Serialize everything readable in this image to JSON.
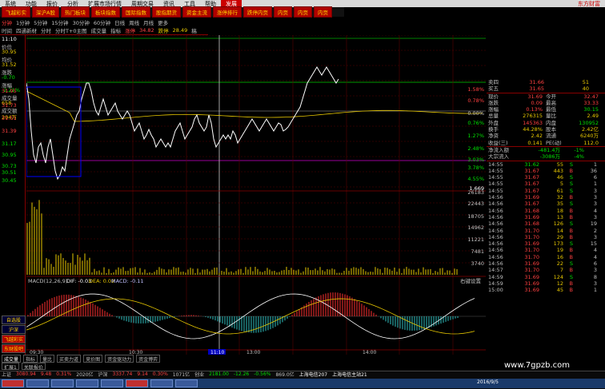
{
  "menubar": {
    "items": [
      "系统",
      "功能",
      "报价",
      "分析",
      "扩展市场行情",
      "周期交易",
      "资讯",
      "工具",
      "帮助"
    ],
    "highlight": "发展",
    "right": "东方财富"
  },
  "quick_tabs": [
    "飞越彩实",
    "深沪A股",
    "热门板块",
    "板块指数",
    "国际指数",
    "股指期货",
    "资金主流",
    "涨停排行",
    "跌停内页",
    "内页",
    "内页",
    "内页"
  ],
  "periods": {
    "items": [
      "分钟",
      "1分钟",
      "5分钟",
      "15分钟",
      "30分钟",
      "60分钟",
      "日线",
      "周线",
      "月线",
      "更多"
    ],
    "active": "分钟"
  },
  "chart_tools": {
    "items": [
      "时间",
      "四通新材",
      "分时",
      "分时T+0主图",
      "成交量",
      "指标",
      "涨停",
      "34.82",
      "跌停",
      "28.49",
      "稿"
    ]
  },
  "left_info": {
    "time_label": "11:10",
    "price_label": "价位",
    "price_value": "30.95",
    "avg_label": "均价",
    "avg_value": "31.52",
    "chg_label": "涨跌",
    "chg_value": "-0.70",
    "pct_label": "涨幅",
    "pct_value": "-2.21%",
    "vol_label": "成交量",
    "vol_value": "658",
    "amt_label": "成交额",
    "amt_value": "204万"
  },
  "left_price_axis": [
    "31.95",
    "31.73",
    "31.51",
    "31.39",
    "31.17",
    "30.95",
    "30.73",
    "30.51",
    "30.45",
    "30.21"
  ],
  "right_pct_axis": [
    "1.58%",
    "0.78%",
    "0.00%",
    "0.76%",
    "1.27%",
    "2.48%",
    "3.03%",
    "3.78%",
    "4.55%"
  ],
  "right_vol_axis": [
    "1.669",
    "26183",
    "22443",
    "18705",
    "14962",
    "11221",
    "7481",
    "3740"
  ],
  "macd": {
    "label": "MACD(12,26,9)",
    "dif": "DIF: -0.03",
    "dea": "DEA: 0.02",
    "macd": "MACD: -0.11",
    "hint": "右键设置"
  },
  "time_axis": {
    "labels": [
      "09:30",
      "10:30",
      "11:10",
      "13:00",
      "14:00"
    ]
  },
  "side_buttons": [
    "自选股",
    "沪深",
    "飞越彩实",
    "东财股吧"
  ],
  "bottom_tabs": [
    "成交量",
    "指标",
    "量比",
    "买卖力道",
    "竞价图",
    "资金驱动力",
    "资金博弈"
  ],
  "bottom_tabs2": [
    "扩展1",
    "关联报价"
  ],
  "orderbook": [
    {
      "label": "卖四",
      "price": "31.66",
      "vol": "51"
    },
    {
      "label": "买五",
      "price": "31.65",
      "vol": "40"
    }
  ],
  "stats": [
    {
      "k1": "现价",
      "v1": "31.69",
      "c1": "#ff4040",
      "k2": "今开",
      "v2": "32.47",
      "c2": "#ff4040"
    },
    {
      "k1": "涨跌",
      "v1": "0.09",
      "c1": "#ff4040",
      "k2": "最高",
      "v2": "33.33",
      "c2": "#ff4040"
    },
    {
      "k1": "涨幅",
      "v1": "0.13%",
      "c1": "#ff4040",
      "k2": "最低",
      "v2": "30.15",
      "c2": "#00e000"
    },
    {
      "k1": "总量",
      "v1": "276315",
      "c1": "#e8c800",
      "k2": "量比",
      "v2": "2.49",
      "c2": "#e8c800"
    },
    {
      "k1": "外盘",
      "v1": "145363",
      "c1": "#ff4040",
      "k2": "内盘",
      "v2": "130952",
      "c2": "#00e000"
    },
    {
      "k1": "换手",
      "v1": "44.28%",
      "c1": "#e8c800",
      "k2": "股本",
      "v2": "2.42亿",
      "c2": "#e8c800"
    },
    {
      "k1": "净资",
      "v1": "2.42",
      "c1": "#e8c800",
      "k2": "流通",
      "v2": "6240万",
      "c2": "#e8c800"
    },
    {
      "k1": "收益(三)",
      "v1": "0.141",
      "c1": "#e8c800",
      "k2": "PE(动)",
      "v2": "112.0",
      "c2": "#e8c800"
    }
  ],
  "flows": [
    {
      "k": "净流入额",
      "v1": "-481.4万",
      "v2": "-1%"
    },
    {
      "k": "大宗流入",
      "v1": "-3086万",
      "v2": "-4%"
    }
  ],
  "ticks": [
    {
      "t": "14:55",
      "p": "31.62",
      "v": "55",
      "s": "S",
      "n": "1"
    },
    {
      "t": "14:55",
      "p": "31.67",
      "v": "443",
      "s": "B",
      "n": "36"
    },
    {
      "t": "14:55",
      "p": "31.67",
      "v": "46",
      "s": "S",
      "n": "6"
    },
    {
      "t": "14:55",
      "p": "31.67",
      "v": "5",
      "s": "S",
      "n": "1"
    },
    {
      "t": "14:55",
      "p": "31.67",
      "v": "61",
      "s": "S",
      "n": "3"
    },
    {
      "t": "14:56",
      "p": "31.69",
      "v": "32",
      "s": "B",
      "n": "3"
    },
    {
      "t": "14:56",
      "p": "31.67",
      "v": "35",
      "s": "S",
      "n": "3"
    },
    {
      "t": "14:56",
      "p": "31.68",
      "v": "18",
      "s": "B",
      "n": "4"
    },
    {
      "t": "14:56",
      "p": "31.69",
      "v": "13",
      "s": "B",
      "n": "3"
    },
    {
      "t": "14:56",
      "p": "31.68",
      "v": "126",
      "s": "S",
      "n": "19"
    },
    {
      "t": "14:56",
      "p": "31.70",
      "v": "14",
      "s": "B",
      "n": "2"
    },
    {
      "t": "14:56",
      "p": "31.70",
      "v": "29",
      "s": "B",
      "n": "3"
    },
    {
      "t": "14:56",
      "p": "31.69",
      "v": "173",
      "s": "S",
      "n": "15"
    },
    {
      "t": "14:56",
      "p": "31.70",
      "v": "19",
      "s": "B",
      "n": "4"
    },
    {
      "t": "14:56",
      "p": "31.70",
      "v": "16",
      "s": "B",
      "n": "4"
    },
    {
      "t": "14:56",
      "p": "31.69",
      "v": "22",
      "s": "S",
      "n": "6"
    },
    {
      "t": "14:57",
      "p": "31.70",
      "v": "7",
      "s": "B",
      "n": "3"
    },
    {
      "t": "14:59",
      "p": "31.69",
      "v": "124",
      "s": "S",
      "n": "8"
    },
    {
      "t": "14:59",
      "p": "31.69",
      "v": "12",
      "s": "B",
      "n": "3"
    },
    {
      "t": "15:00",
      "p": "31.69",
      "v": "45",
      "s": "B",
      "n": "1"
    }
  ],
  "status": [
    {
      "k": "上证",
      "v": "3080.94",
      "c": "#ff4040"
    },
    {
      "k": "",
      "v": "9.48",
      "c": "#ff4040"
    },
    {
      "k": "",
      "v": "0.31%",
      "c": "#ff4040"
    },
    {
      "k": "",
      "v": "2020亿",
      "c": "#c0c0c0"
    },
    {
      "k": "沪深",
      "v": "3337.74",
      "c": "#ff4040"
    },
    {
      "k": "",
      "v": "9.14",
      "c": "#ff4040"
    },
    {
      "k": "",
      "v": "0.30%",
      "c": "#ff4040"
    },
    {
      "k": "",
      "v": "1071亿",
      "c": "#c0c0c0"
    },
    {
      "k": "创业",
      "v": "2181.00",
      "c": "#00e000"
    },
    {
      "k": "",
      "v": "-12.26",
      "c": "#00e000"
    },
    {
      "k": "",
      "v": "-0.56%",
      "c": "#00e000"
    },
    {
      "k": "",
      "v": "869.0亿",
      "c": "#c0c0c0"
    },
    {
      "k": "",
      "v": "上海电信207",
      "c": "#fff"
    },
    {
      "k": "",
      "v": "上海电信主站21",
      "c": "#fff"
    }
  ],
  "watermark": "www.7gpzb.com",
  "statusright": "2016/9/5"
}
